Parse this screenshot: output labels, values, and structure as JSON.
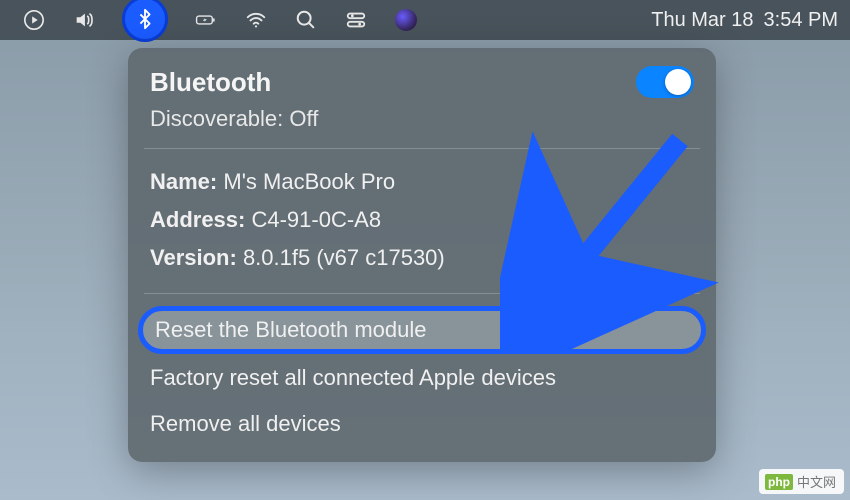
{
  "menubar": {
    "datetime_day": "Thu Mar 18",
    "datetime_time": "3:54 PM"
  },
  "dropdown": {
    "title": "Bluetooth",
    "toggle_on": true,
    "discoverable_label": "Discoverable:",
    "discoverable_value": "Off",
    "info": {
      "name_label": "Name:",
      "name_value": "M's MacBook Pro",
      "address_label": "Address:",
      "address_value": "C4-91-0C-A8",
      "version_label": "Version:",
      "version_value": "8.0.1f5 (v67 c17530)"
    },
    "items": [
      "Reset the Bluetooth module",
      "Factory reset all connected Apple devices",
      "Remove all devices"
    ]
  },
  "watermark": {
    "logo": "php",
    "text": "中文网"
  }
}
